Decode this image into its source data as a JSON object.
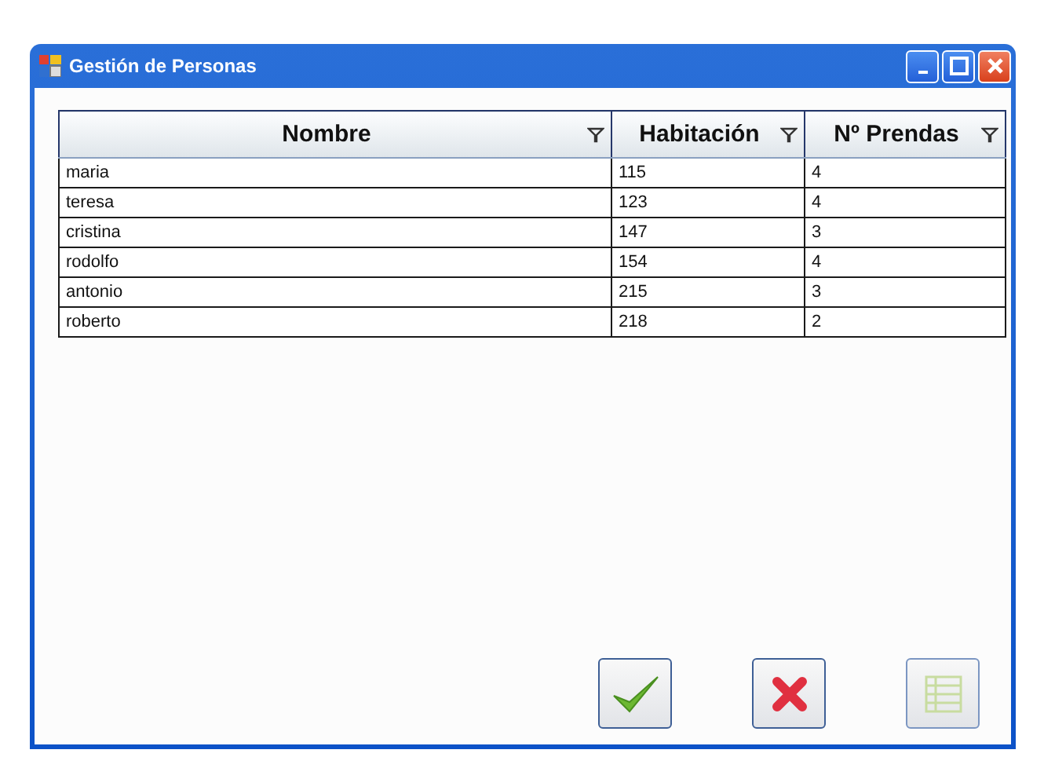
{
  "window": {
    "title": "Gestión de Personas"
  },
  "table": {
    "columns": [
      "Nombre",
      "Habitación",
      "Nº Prendas"
    ],
    "rows": [
      [
        "maria",
        "115",
        "4"
      ],
      [
        "teresa",
        "123",
        "4"
      ],
      [
        "cristina",
        "147",
        "3"
      ],
      [
        "rodolfo",
        "154",
        "4"
      ],
      [
        "antonio",
        "215",
        "3"
      ],
      [
        "roberto",
        "218",
        "2"
      ]
    ]
  },
  "buttons": [
    {
      "kind": "accept",
      "disabled": false
    },
    {
      "kind": "cancel",
      "disabled": false
    },
    {
      "kind": "list",
      "disabled": true
    }
  ]
}
